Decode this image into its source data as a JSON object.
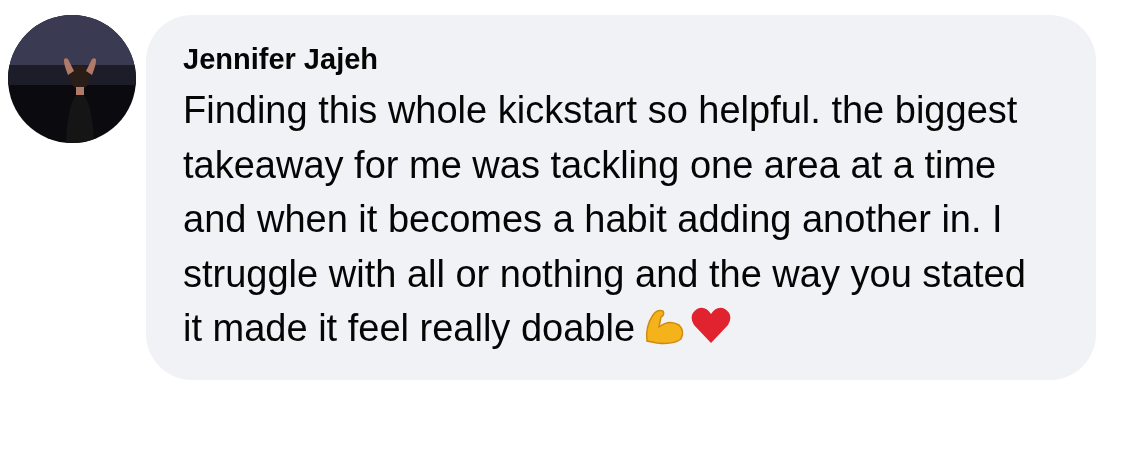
{
  "comment": {
    "author": "Jennifer Jajeh",
    "text": "Finding this whole kickstart so helpful. the biggest takeaway for me was tackling one area at a time and when it becomes a habit adding another in. I struggle with all or nothing and the way you stated it made it feel really doable"
  }
}
